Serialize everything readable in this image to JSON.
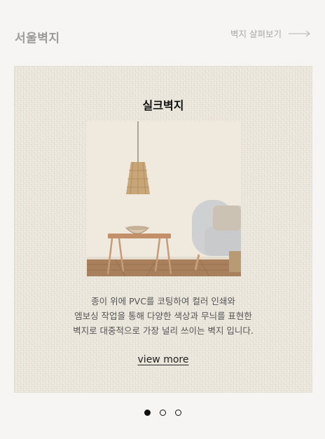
{
  "header": {
    "brand": "서울벽지",
    "browse_link": "벽지 살펴보기"
  },
  "card": {
    "title": "실크벽지",
    "description_lines": [
      "종이 위에 PVC를 코팅하여 컬러 인쇄와",
      "엠보싱 작업을 통해 다양한 색상과 무늬를 표현한",
      "벽지로 대중적으로 가장 널리 쓰이는 벽지 입니다."
    ],
    "more_label": "view more"
  },
  "carousel": {
    "total": 3,
    "active_index": 0
  }
}
